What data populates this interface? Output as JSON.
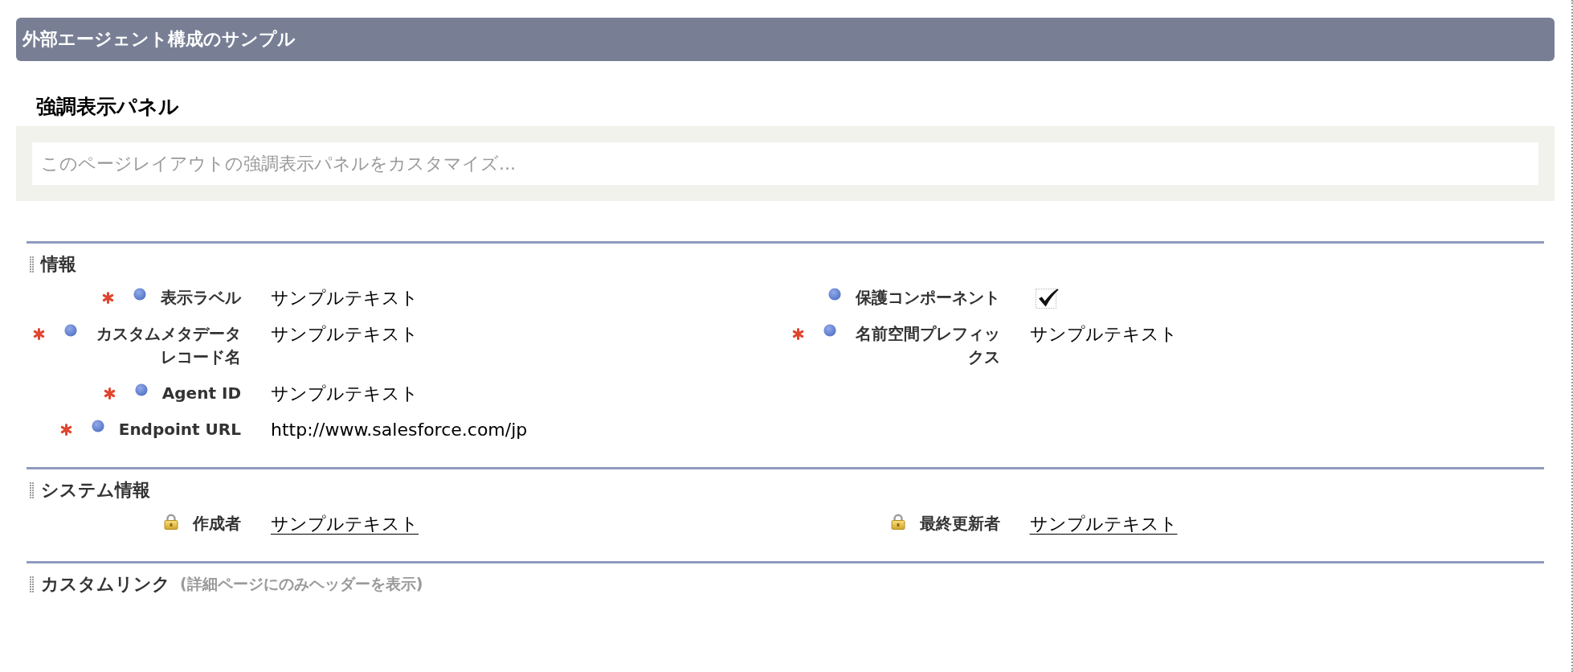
{
  "header": {
    "title": "外部エージェント構成のサンプル"
  },
  "highlights_panel": {
    "title": "強調表示パネル",
    "hint": "このページレイアウトの強調表示パネルをカスタマイズ..."
  },
  "sections": [
    {
      "title": "情報",
      "columns": [
        [
          {
            "label": "表示ラベル",
            "required": true,
            "always_on_layout": true,
            "read_only": false,
            "kind": "text",
            "value": "サンプルテキスト"
          },
          {
            "label": "カスタムメタデータレコード名",
            "required": true,
            "always_on_layout": true,
            "read_only": false,
            "kind": "text",
            "value": "サンプルテキスト"
          },
          {
            "label": "Agent ID",
            "required": true,
            "always_on_layout": true,
            "read_only": false,
            "kind": "text",
            "value": "サンプルテキスト"
          },
          {
            "label": "Endpoint URL",
            "required": true,
            "always_on_layout": true,
            "read_only": false,
            "kind": "text",
            "value": "http://www.salesforce.com/jp"
          }
        ],
        [
          {
            "label": "保護コンポーネント",
            "required": false,
            "always_on_layout": true,
            "read_only": false,
            "kind": "checkbox",
            "checked": true
          },
          {
            "label": "名前空間プレフィックス",
            "required": true,
            "always_on_layout": true,
            "read_only": false,
            "kind": "text",
            "value": "サンプルテキスト"
          }
        ]
      ]
    },
    {
      "title": "システム情報",
      "columns": [
        [
          {
            "label": "作成者",
            "required": false,
            "always_on_layout": false,
            "read_only": true,
            "kind": "link",
            "value": "サンプルテキスト"
          }
        ],
        [
          {
            "label": "最終更新者",
            "required": false,
            "always_on_layout": false,
            "read_only": true,
            "kind": "link",
            "value": "サンプルテキスト"
          }
        ]
      ]
    },
    {
      "title": "カスタムリンク",
      "subtitle": "(詳細ページにのみヘッダーを表示)"
    }
  ]
}
